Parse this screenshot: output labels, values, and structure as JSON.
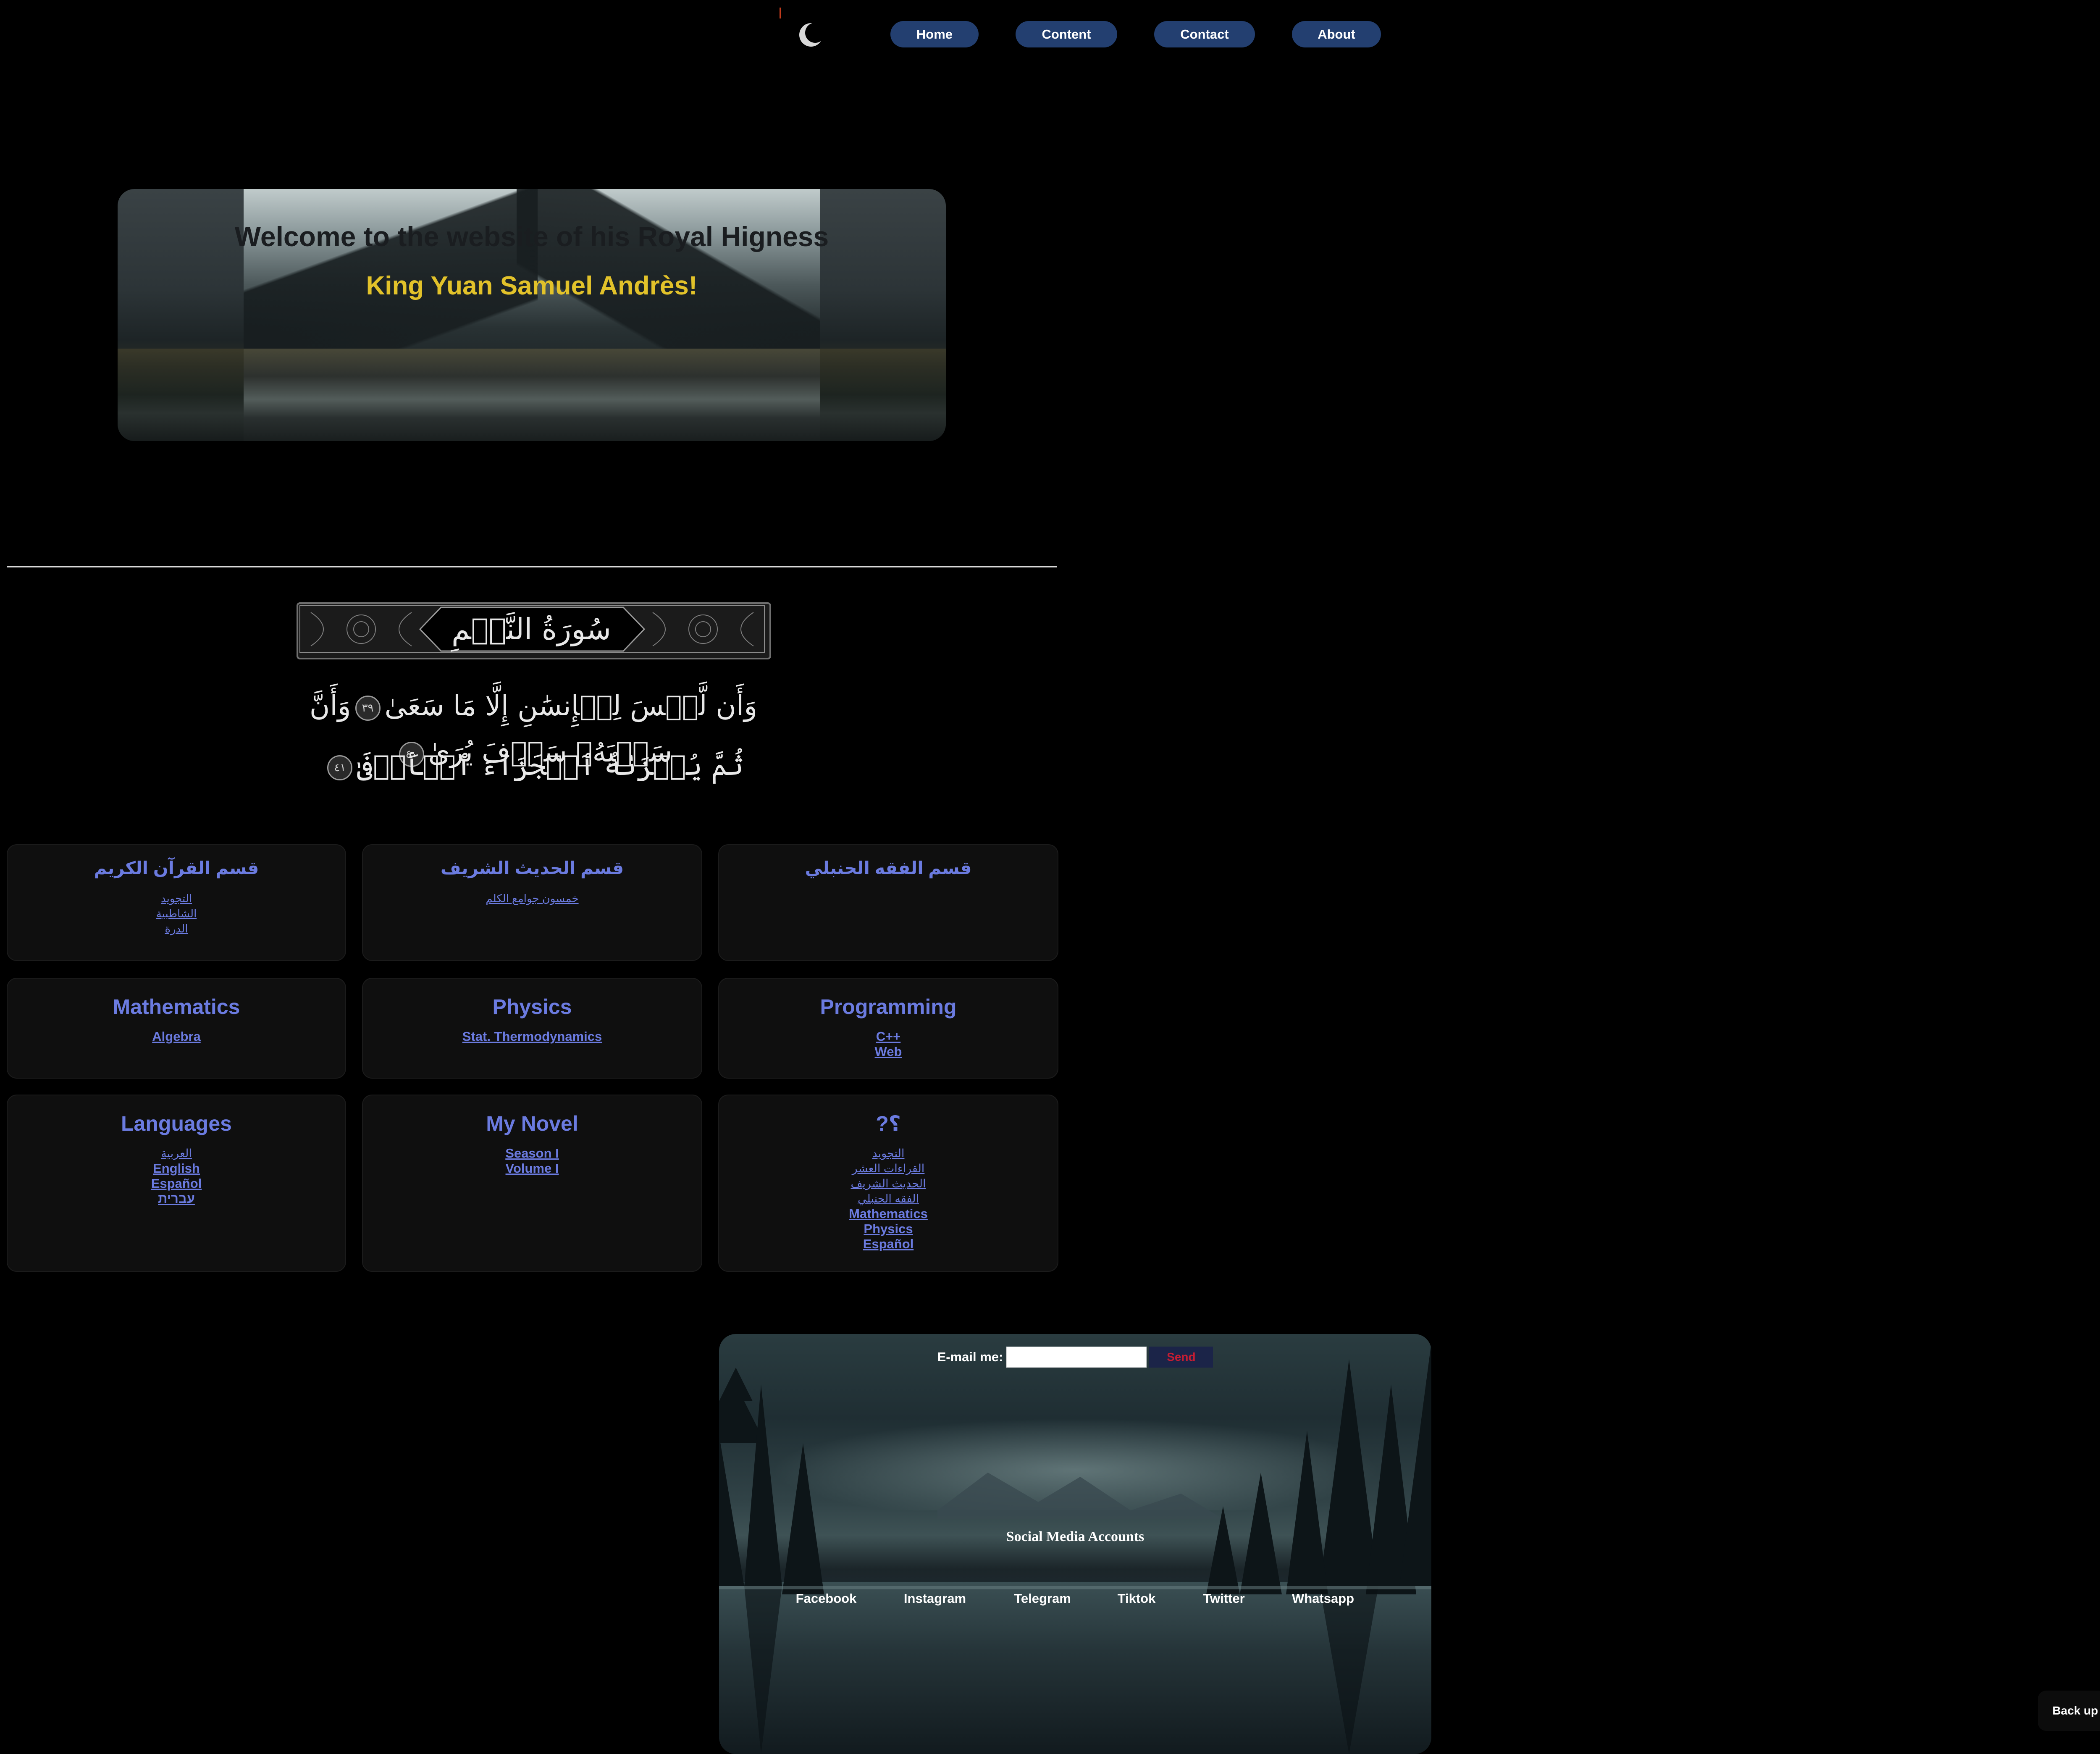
{
  "nav": {
    "items": [
      {
        "label": "Home"
      },
      {
        "label": "Content"
      },
      {
        "label": "Contact"
      },
      {
        "label": "About"
      }
    ],
    "theme_icon": "crescent-moon-icon"
  },
  "hero": {
    "title": "Welcome to the website of his Royal Higness",
    "name": "King Yuan Samuel Andrès!",
    "name_color": "#e2c22a"
  },
  "surah": {
    "name": "سُورَةُ النَّجۡمِ",
    "ayah_line_1": "وَأَن لَّيۡسَ لِلۡإِنسَٰنِ إِلَّا مَا سَعَىٰ",
    "marker_39": "٣٩",
    "ayah_line_1b": "وَأَنَّ سَعۡيَهُۥ سَوۡفَ يُرَىٰ",
    "marker_40": "٤٠",
    "ayah_line_2": "ثُمَّ يُجۡزَىٰهُ ٱلۡجَزَآءَ ٱلۡأَوۡفَىٰ",
    "marker_41": "٤١"
  },
  "cards": {
    "quran": {
      "title": "قسم القرآن الكريم",
      "links": [
        "التجويد",
        "الشاطبية",
        "الدرة"
      ]
    },
    "hadith": {
      "title": "قسم الحديث الشريف",
      "links": [
        "خمسون جوامع الكلم"
      ]
    },
    "fiqh": {
      "title": "قسم الفقه الحنبلي",
      "links": []
    },
    "math": {
      "title": "Mathematics",
      "links": [
        "Algebra"
      ]
    },
    "physics": {
      "title": "Physics",
      "links": [
        "Stat. Thermodynamics"
      ]
    },
    "programming": {
      "title": "Programming",
      "links": [
        "C++",
        "Web"
      ]
    },
    "languages": {
      "title": "Languages",
      "links": [
        "العربية",
        "English",
        "Español",
        "עברית"
      ]
    },
    "novel": {
      "title": "My Novel",
      "links": [
        "Season I",
        "Volume I"
      ]
    },
    "misc": {
      "title": "?؟",
      "links": [
        "التجويد",
        "القراءات العشر",
        "الحديث الشريف",
        "الفقه الحنبلي",
        "Mathematics",
        "Physics",
        "Español"
      ]
    }
  },
  "colors": {
    "link": "#6b7be0",
    "nav_bg": "#233f70",
    "send_text": "#c51d33"
  },
  "footer": {
    "email_label": "E-mail me:",
    "email_value": "",
    "send_label": "Send",
    "social_title": "Social Media Accounts",
    "social": [
      "Facebook",
      "Instagram",
      "Telegram",
      "Tiktok",
      "Twitter",
      "Whatsapp"
    ]
  },
  "back_up_label": "Back up"
}
